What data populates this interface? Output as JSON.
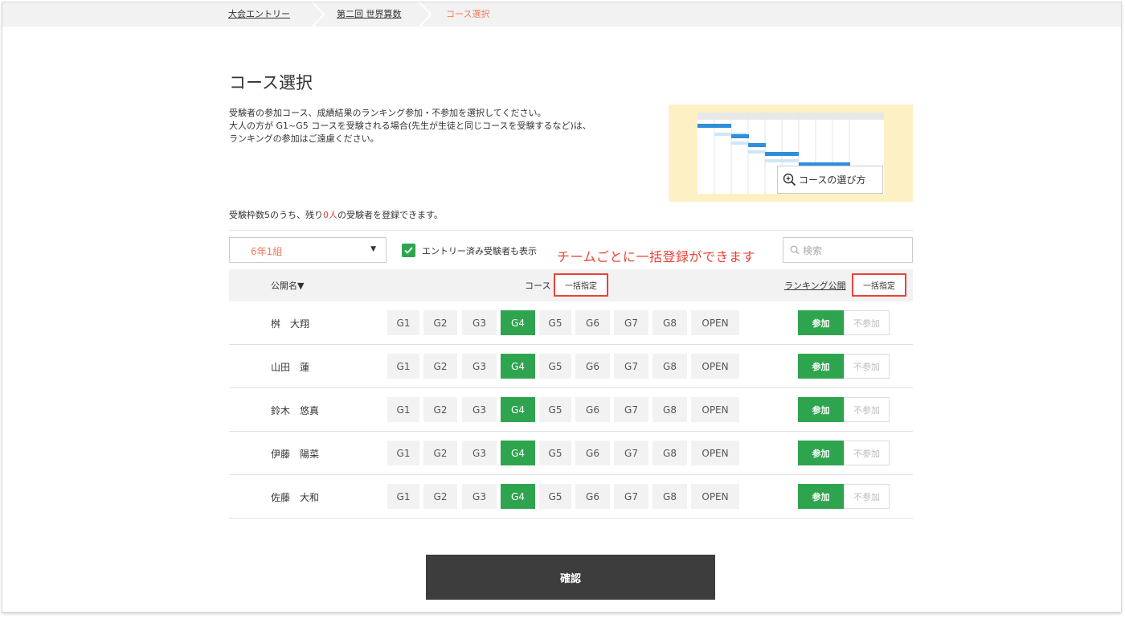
{
  "breadcrumb": {
    "items": [
      "大会エントリー",
      "第二回 世界算数",
      "コース選択"
    ]
  },
  "page": {
    "title": "コース選択",
    "description_lines": [
      "受験者の参加コース、成績結果のランキング参加・不参加を選択してください。",
      "大人の方が G1~G5 コースを受験される場合(先生が生徒と同じコースを受験するなど)は、",
      "ランキングの参加はご遠慮ください。"
    ]
  },
  "help": {
    "button_label": "コースの選び方",
    "icon": "zoom-in-icon"
  },
  "quota": {
    "prefix": "受験枠数5のうち、残り",
    "remaining": "0人",
    "suffix": "の受験者を登録できます。"
  },
  "filters": {
    "class_value": "6年1組",
    "show_entered_label": "エントリー済み受験者も表示",
    "show_entered_checked": true,
    "search_placeholder": "検索"
  },
  "annotation": "チームごとに一括登録ができます",
  "table": {
    "header_name": "公開名▼",
    "header_course": "コース",
    "bulk_label": "一括指定",
    "header_ranking": "ランキング公開",
    "course_options": [
      "G1",
      "G2",
      "G3",
      "G4",
      "G5",
      "G6",
      "G7",
      "G8",
      "OPEN"
    ],
    "ranking_join": "参加",
    "ranking_nojoin": "不参加",
    "rows": [
      {
        "name": "桝　大翔",
        "course": "G4",
        "ranking": "参加"
      },
      {
        "name": "山田　蓮",
        "course": "G4",
        "ranking": "参加"
      },
      {
        "name": "鈴木　悠真",
        "course": "G4",
        "ranking": "参加"
      },
      {
        "name": "伊藤　陽菜",
        "course": "G4",
        "ranking": "参加"
      },
      {
        "name": "佐藤　大和",
        "course": "G4",
        "ranking": "参加"
      }
    ]
  },
  "confirm_label": "確認",
  "colors": {
    "accent_green": "#2fa44f",
    "annotation_red": "#e8433a",
    "current_crumb": "#f07b5a",
    "help_bg": "#fdf0c4"
  }
}
